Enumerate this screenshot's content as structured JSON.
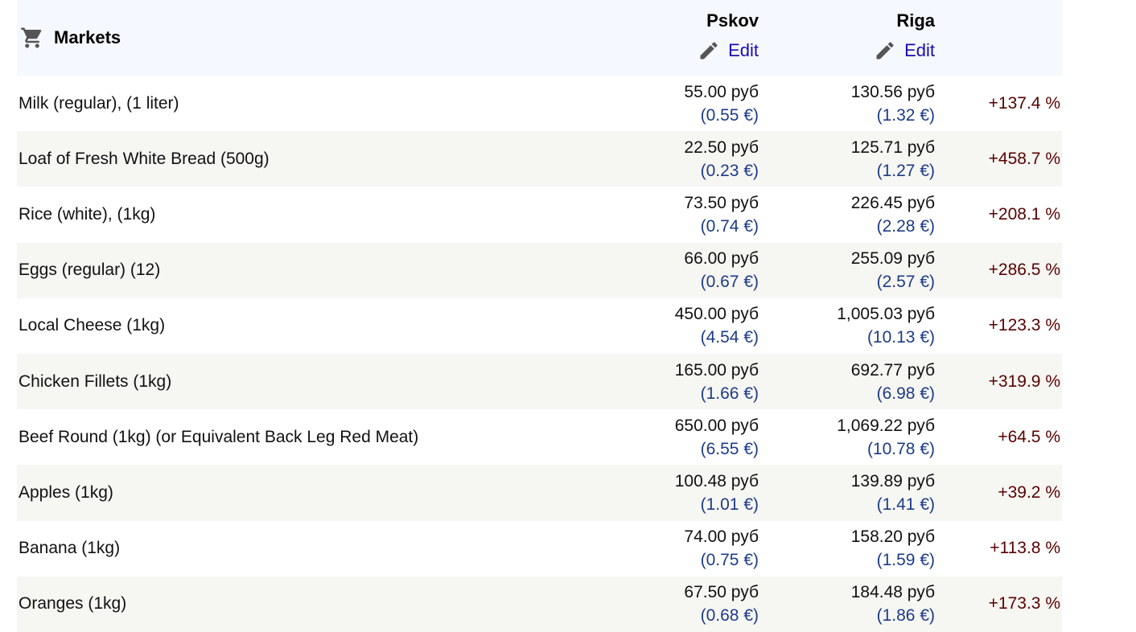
{
  "section": {
    "title": "Markets",
    "icon": "shopping-cart-icon"
  },
  "cities": [
    {
      "name": "Pskov",
      "edit_label": "Edit"
    },
    {
      "name": "Riga",
      "edit_label": "Edit"
    }
  ],
  "colors": {
    "link": "#1a0dab",
    "converted": "#1d3b87",
    "difference": "#5a0000",
    "header_bg": "#f6f8ff",
    "alt_row_bg": "#f6f6f3"
  },
  "rows": [
    {
      "item": "Milk (regular), (1 liter)",
      "city1_local": "55.00 руб",
      "city1_conv": "(0.55 €)",
      "city2_local": "130.56 руб",
      "city2_conv": "(1.32 €)",
      "diff": "+137.4 %"
    },
    {
      "item": "Loaf of Fresh White Bread (500g)",
      "city1_local": "22.50 руб",
      "city1_conv": "(0.23 €)",
      "city2_local": "125.71 руб",
      "city2_conv": "(1.27 €)",
      "diff": "+458.7 %"
    },
    {
      "item": "Rice (white), (1kg)",
      "city1_local": "73.50 руб",
      "city1_conv": "(0.74 €)",
      "city2_local": "226.45 руб",
      "city2_conv": "(2.28 €)",
      "diff": "+208.1 %"
    },
    {
      "item": "Eggs (regular) (12)",
      "city1_local": "66.00 руб",
      "city1_conv": "(0.67 €)",
      "city2_local": "255.09 руб",
      "city2_conv": "(2.57 €)",
      "diff": "+286.5 %"
    },
    {
      "item": "Local Cheese (1kg)",
      "city1_local": "450.00 руб",
      "city1_conv": "(4.54 €)",
      "city2_local": "1,005.03 руб",
      "city2_conv": "(10.13 €)",
      "diff": "+123.3 %"
    },
    {
      "item": "Chicken Fillets (1kg)",
      "city1_local": "165.00 руб",
      "city1_conv": "(1.66 €)",
      "city2_local": "692.77 руб",
      "city2_conv": "(6.98 €)",
      "diff": "+319.9 %"
    },
    {
      "item": "Beef Round (1kg) (or Equivalent Back Leg Red Meat)",
      "city1_local": "650.00 руб",
      "city1_conv": "(6.55 €)",
      "city2_local": "1,069.22 руб",
      "city2_conv": "(10.78 €)",
      "diff": "+64.5 %"
    },
    {
      "item": "Apples (1kg)",
      "city1_local": "100.48 руб",
      "city1_conv": "(1.01 €)",
      "city2_local": "139.89 руб",
      "city2_conv": "(1.41 €)",
      "diff": "+39.2 %"
    },
    {
      "item": "Banana (1kg)",
      "city1_local": "74.00 руб",
      "city1_conv": "(0.75 €)",
      "city2_local": "158.20 руб",
      "city2_conv": "(1.59 €)",
      "diff": "+113.8 %"
    },
    {
      "item": "Oranges (1kg)",
      "city1_local": "67.50 руб",
      "city1_conv": "(0.68 €)",
      "city2_local": "184.48 руб",
      "city2_conv": "(1.86 €)",
      "diff": "+173.3 %"
    }
  ]
}
